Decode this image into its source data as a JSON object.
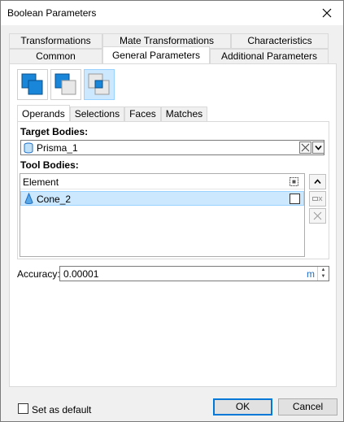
{
  "window": {
    "title": "Boolean Parameters"
  },
  "tabs_row1": [
    {
      "label": "Transformations"
    },
    {
      "label": "Mate Transformations"
    },
    {
      "label": "Characteristics"
    }
  ],
  "tabs_row2": [
    {
      "label": "Common"
    },
    {
      "label": "General Parameters",
      "active": true
    },
    {
      "label": "Additional Parameters"
    }
  ],
  "operation_modes": [
    {
      "icon": "union-icon"
    },
    {
      "icon": "subtract-icon"
    },
    {
      "icon": "intersect-icon",
      "active": true
    }
  ],
  "inner_tabs": [
    {
      "label": "Operands",
      "active": true
    },
    {
      "label": "Selections"
    },
    {
      "label": "Faces"
    },
    {
      "label": "Matches"
    }
  ],
  "target": {
    "label": "Target Bodies:",
    "value": "Prisma_1",
    "icon": "cylinder-icon"
  },
  "tool": {
    "label": "Tool Bodies:",
    "column_header": "Element",
    "rows": [
      {
        "value": "Cone_2",
        "icon": "cone-icon",
        "selected": true
      }
    ]
  },
  "accuracy": {
    "label": "Accuracy:",
    "value": "0.00001",
    "unit": "m"
  },
  "footer": {
    "default_label": "Set as default",
    "ok_label": "OK",
    "cancel_label": "Cancel"
  },
  "colors": {
    "accent": "#0078d7",
    "selection": "#cce8ff",
    "unit": "#1f6fc5",
    "mode_blue": "#1a86d9"
  }
}
